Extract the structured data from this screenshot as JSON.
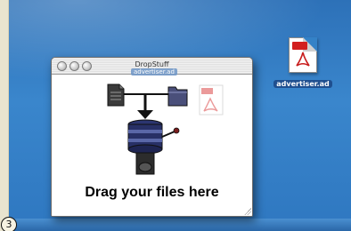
{
  "desktop": {
    "file_icon": {
      "icon": "pdf-document-icon",
      "label": "advertiser.ad"
    }
  },
  "window": {
    "title": "DropStuff",
    "drop_prompt": "Drag your files here",
    "dragged_file_label": "advertiser.ad"
  },
  "annotation": {
    "number": "3"
  },
  "colors": {
    "desktop_blue": "#2f78c1",
    "pdf_red": "#d21f1f",
    "window_white": "#ffffff"
  }
}
